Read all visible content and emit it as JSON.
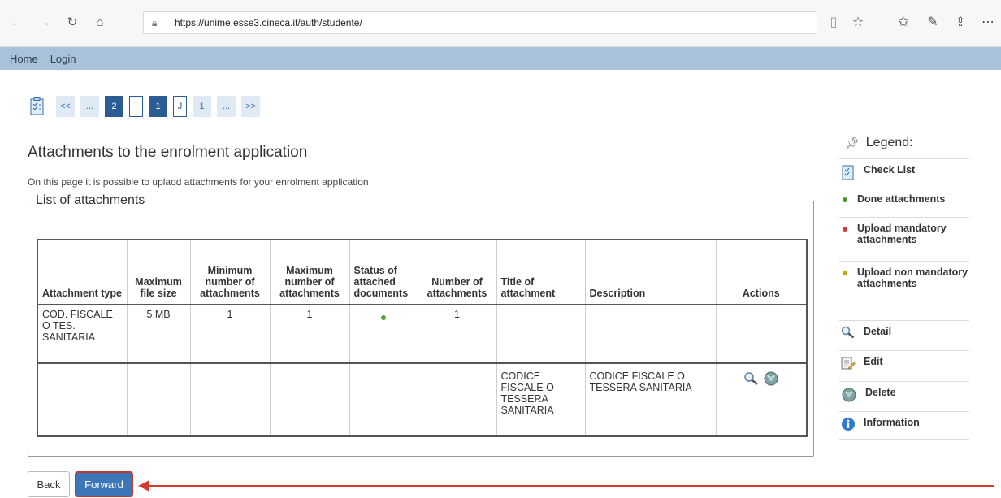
{
  "browser": {
    "url": "https://unime.esse3.cineca.it/auth/studente/"
  },
  "nav": {
    "home": "Home",
    "login": "Login"
  },
  "pager": [
    {
      "label": "<<",
      "style": "light"
    },
    {
      "label": "...",
      "style": "light"
    },
    {
      "label": "2",
      "style": "dark"
    },
    {
      "label": "I",
      "style": "outline"
    },
    {
      "label": "1",
      "style": "dark"
    },
    {
      "label": "J",
      "style": "outline"
    },
    {
      "label": "1",
      "style": "light"
    },
    {
      "label": "...",
      "style": "light"
    },
    {
      "label": ">>",
      "style": "light"
    }
  ],
  "page": {
    "title": "Attachments to the enrolment application",
    "description": "On this page it is possible to uplaod attachments for your enrolment application",
    "fieldset_legend": "List of attachments"
  },
  "table": {
    "headers": [
      "Attachment type",
      "Maximum file size",
      "Minimum number of attachments",
      "Maximum number of attachments",
      "Status of attached documents",
      "Number of attachments",
      "Title of attachment",
      "Description",
      "Actions"
    ],
    "row1": {
      "type": "COD. FISCALE O TES. SANITARIA",
      "max_size": "5 MB",
      "min": "1",
      "max": "1",
      "status": "done",
      "count": "1"
    },
    "row2": {
      "title": "CODICE FISCALE O TESSERA SANITARIA",
      "description": "CODICE FISCALE O TESSERA SANITARIA"
    }
  },
  "buttons": {
    "back": "Back",
    "forward": "Forward"
  },
  "legend": {
    "title": "Legend:",
    "items": [
      {
        "label": "Check List",
        "icon": "checklist-icon"
      },
      {
        "label": "Done attachments",
        "icon": "green-dot",
        "color": "#4a9a2a"
      },
      {
        "label": "Upload mandatory attachments",
        "icon": "red-dot",
        "color": "#d33a3a"
      },
      {
        "label": "Upload non mandatory attachments",
        "icon": "yellow-dot",
        "color": "#c9a800"
      },
      {
        "label": "Detail",
        "icon": "magnifier-icon"
      },
      {
        "label": "Edit",
        "icon": "edit-icon"
      },
      {
        "label": "Delete",
        "icon": "delete-icon"
      },
      {
        "label": "Information",
        "icon": "info-icon"
      }
    ]
  }
}
